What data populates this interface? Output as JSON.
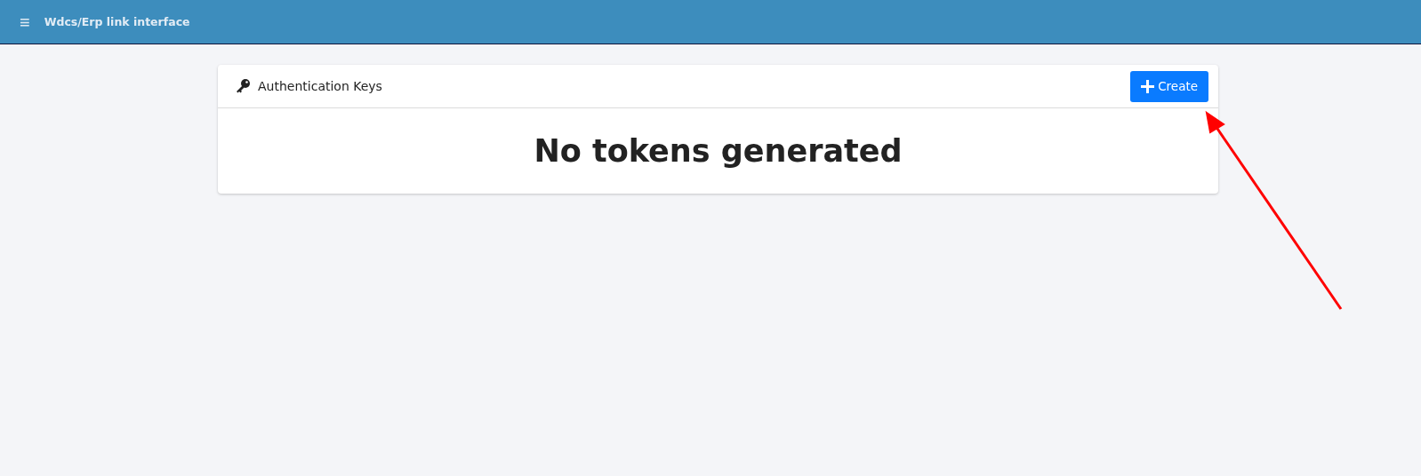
{
  "topbar": {
    "menu_icon": "≡",
    "title": "Wdcs/Erp link interface"
  },
  "card": {
    "title": "Authentication Keys",
    "create_button": "Create",
    "message": "No tokens generated"
  },
  "annotation": {
    "kind": "arrow"
  }
}
